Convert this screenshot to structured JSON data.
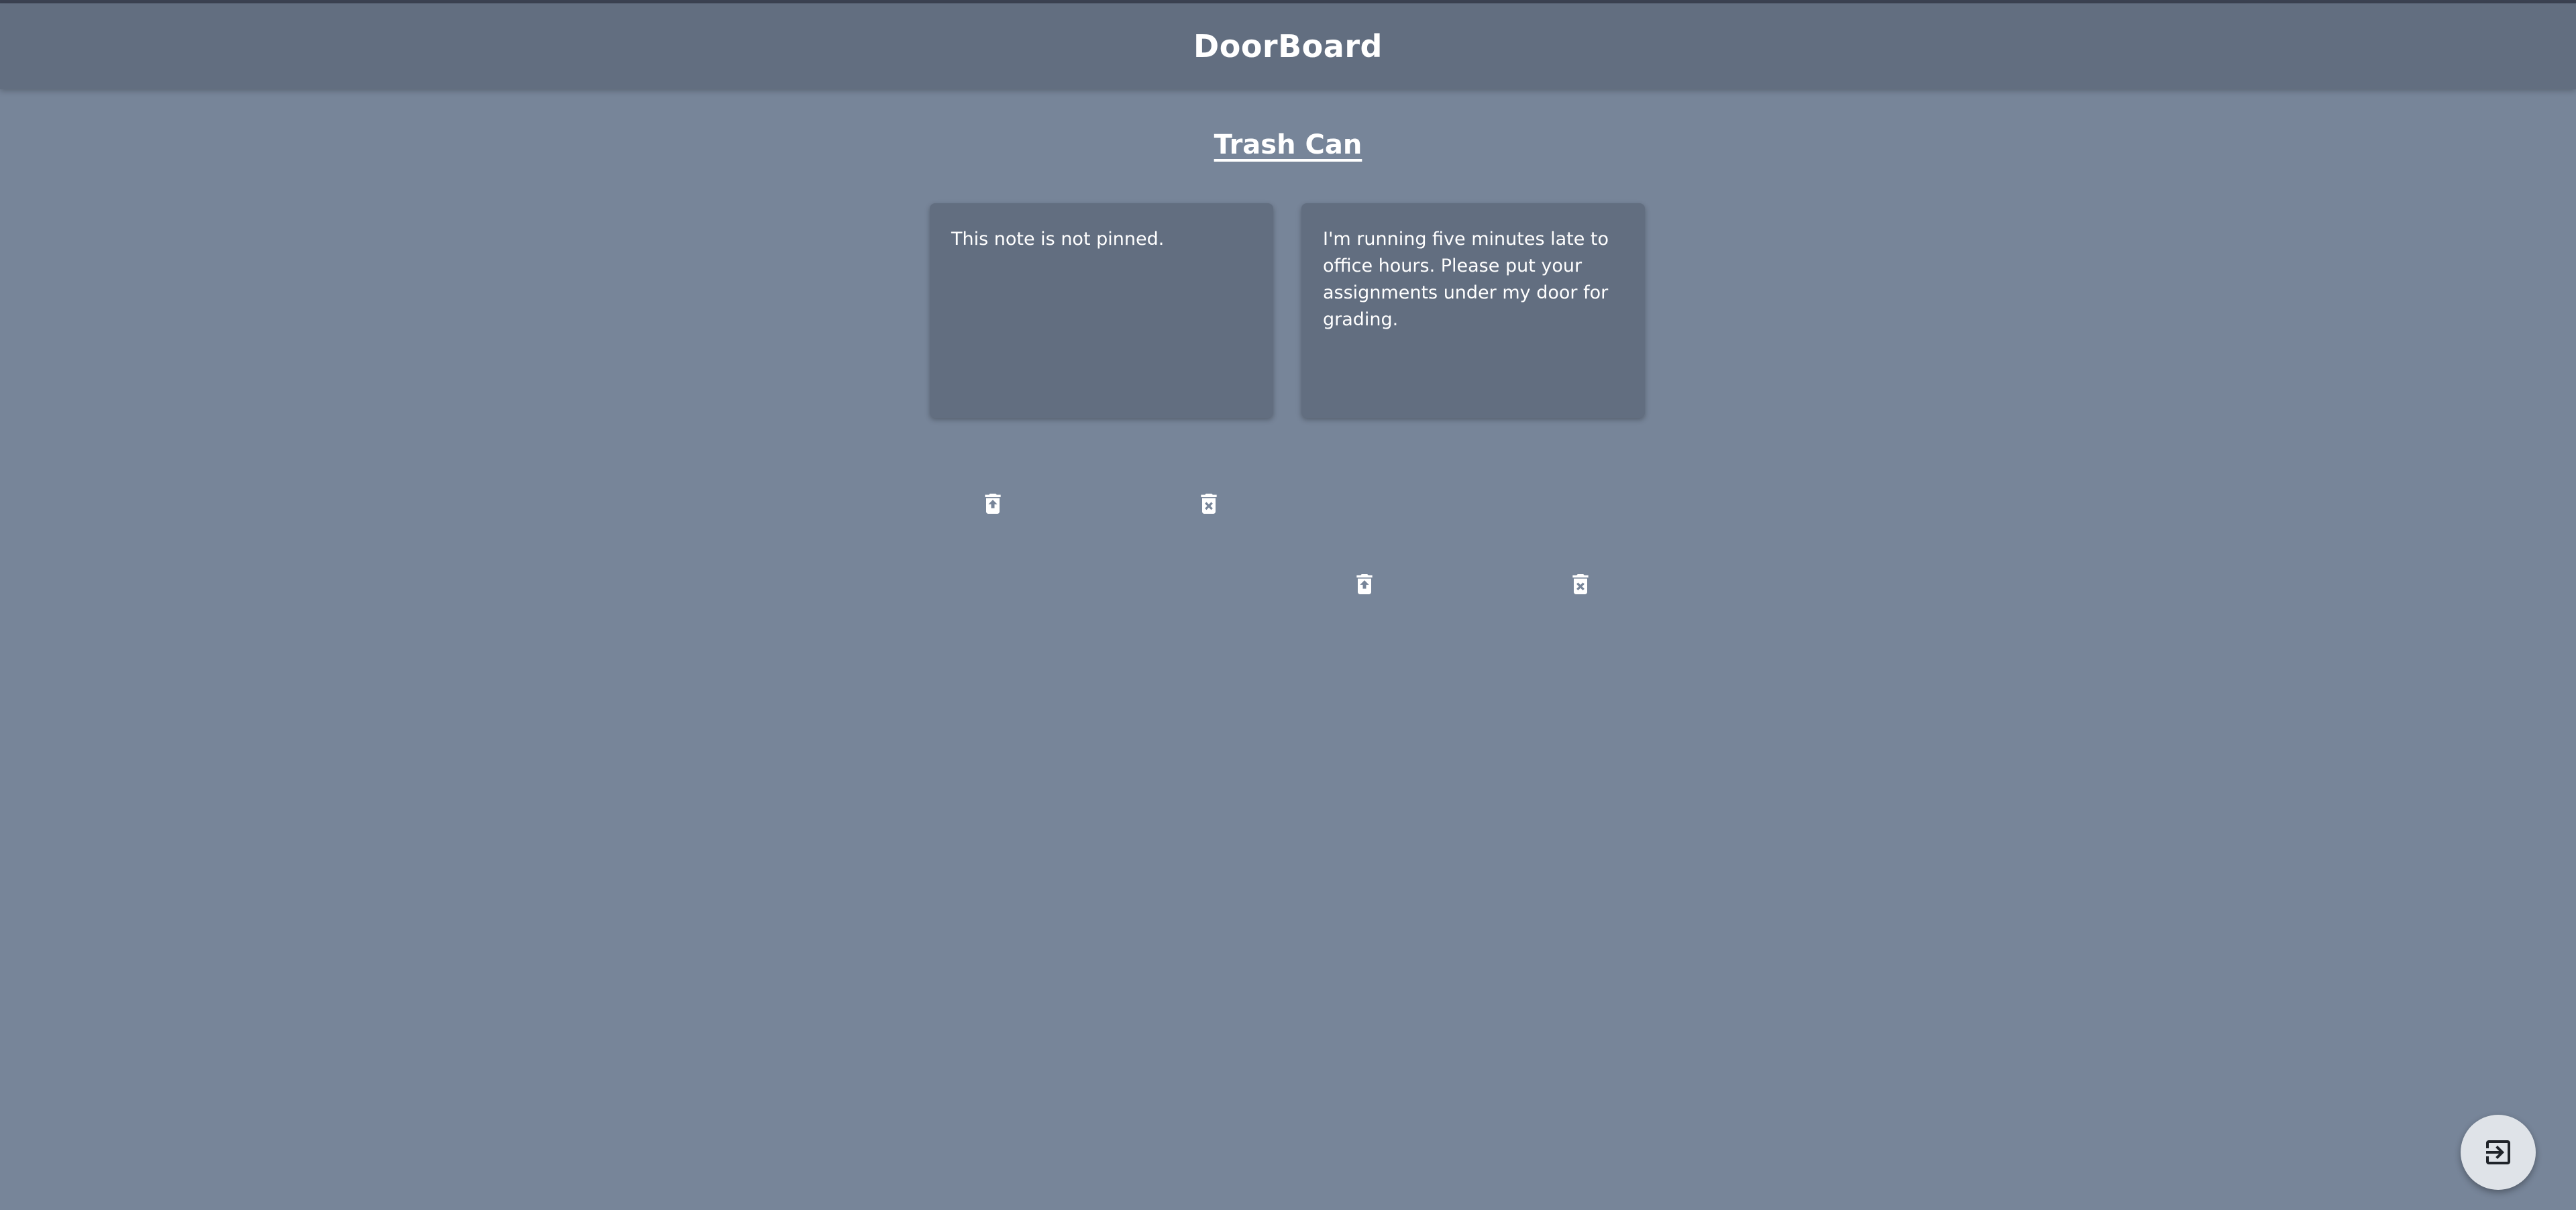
{
  "app": {
    "title": "DoorBoard"
  },
  "section": {
    "title": "Trash Can"
  },
  "notes": [
    {
      "text": "This note is not pinned.",
      "restore_icon": "restore-from-trash-icon",
      "delete_icon": "delete-forever-icon"
    },
    {
      "text": "I'm running five minutes late to office hours. Please put your assignments under my door for grading.",
      "restore_icon": "restore-from-trash-icon",
      "delete_icon": "delete-forever-icon"
    }
  ],
  "fab": {
    "icon": "exit-icon"
  },
  "colors": {
    "background": "#778599",
    "header": "#626e80",
    "card": "#626e80",
    "fab": "#dfe3e8",
    "text": "#ffffff"
  }
}
